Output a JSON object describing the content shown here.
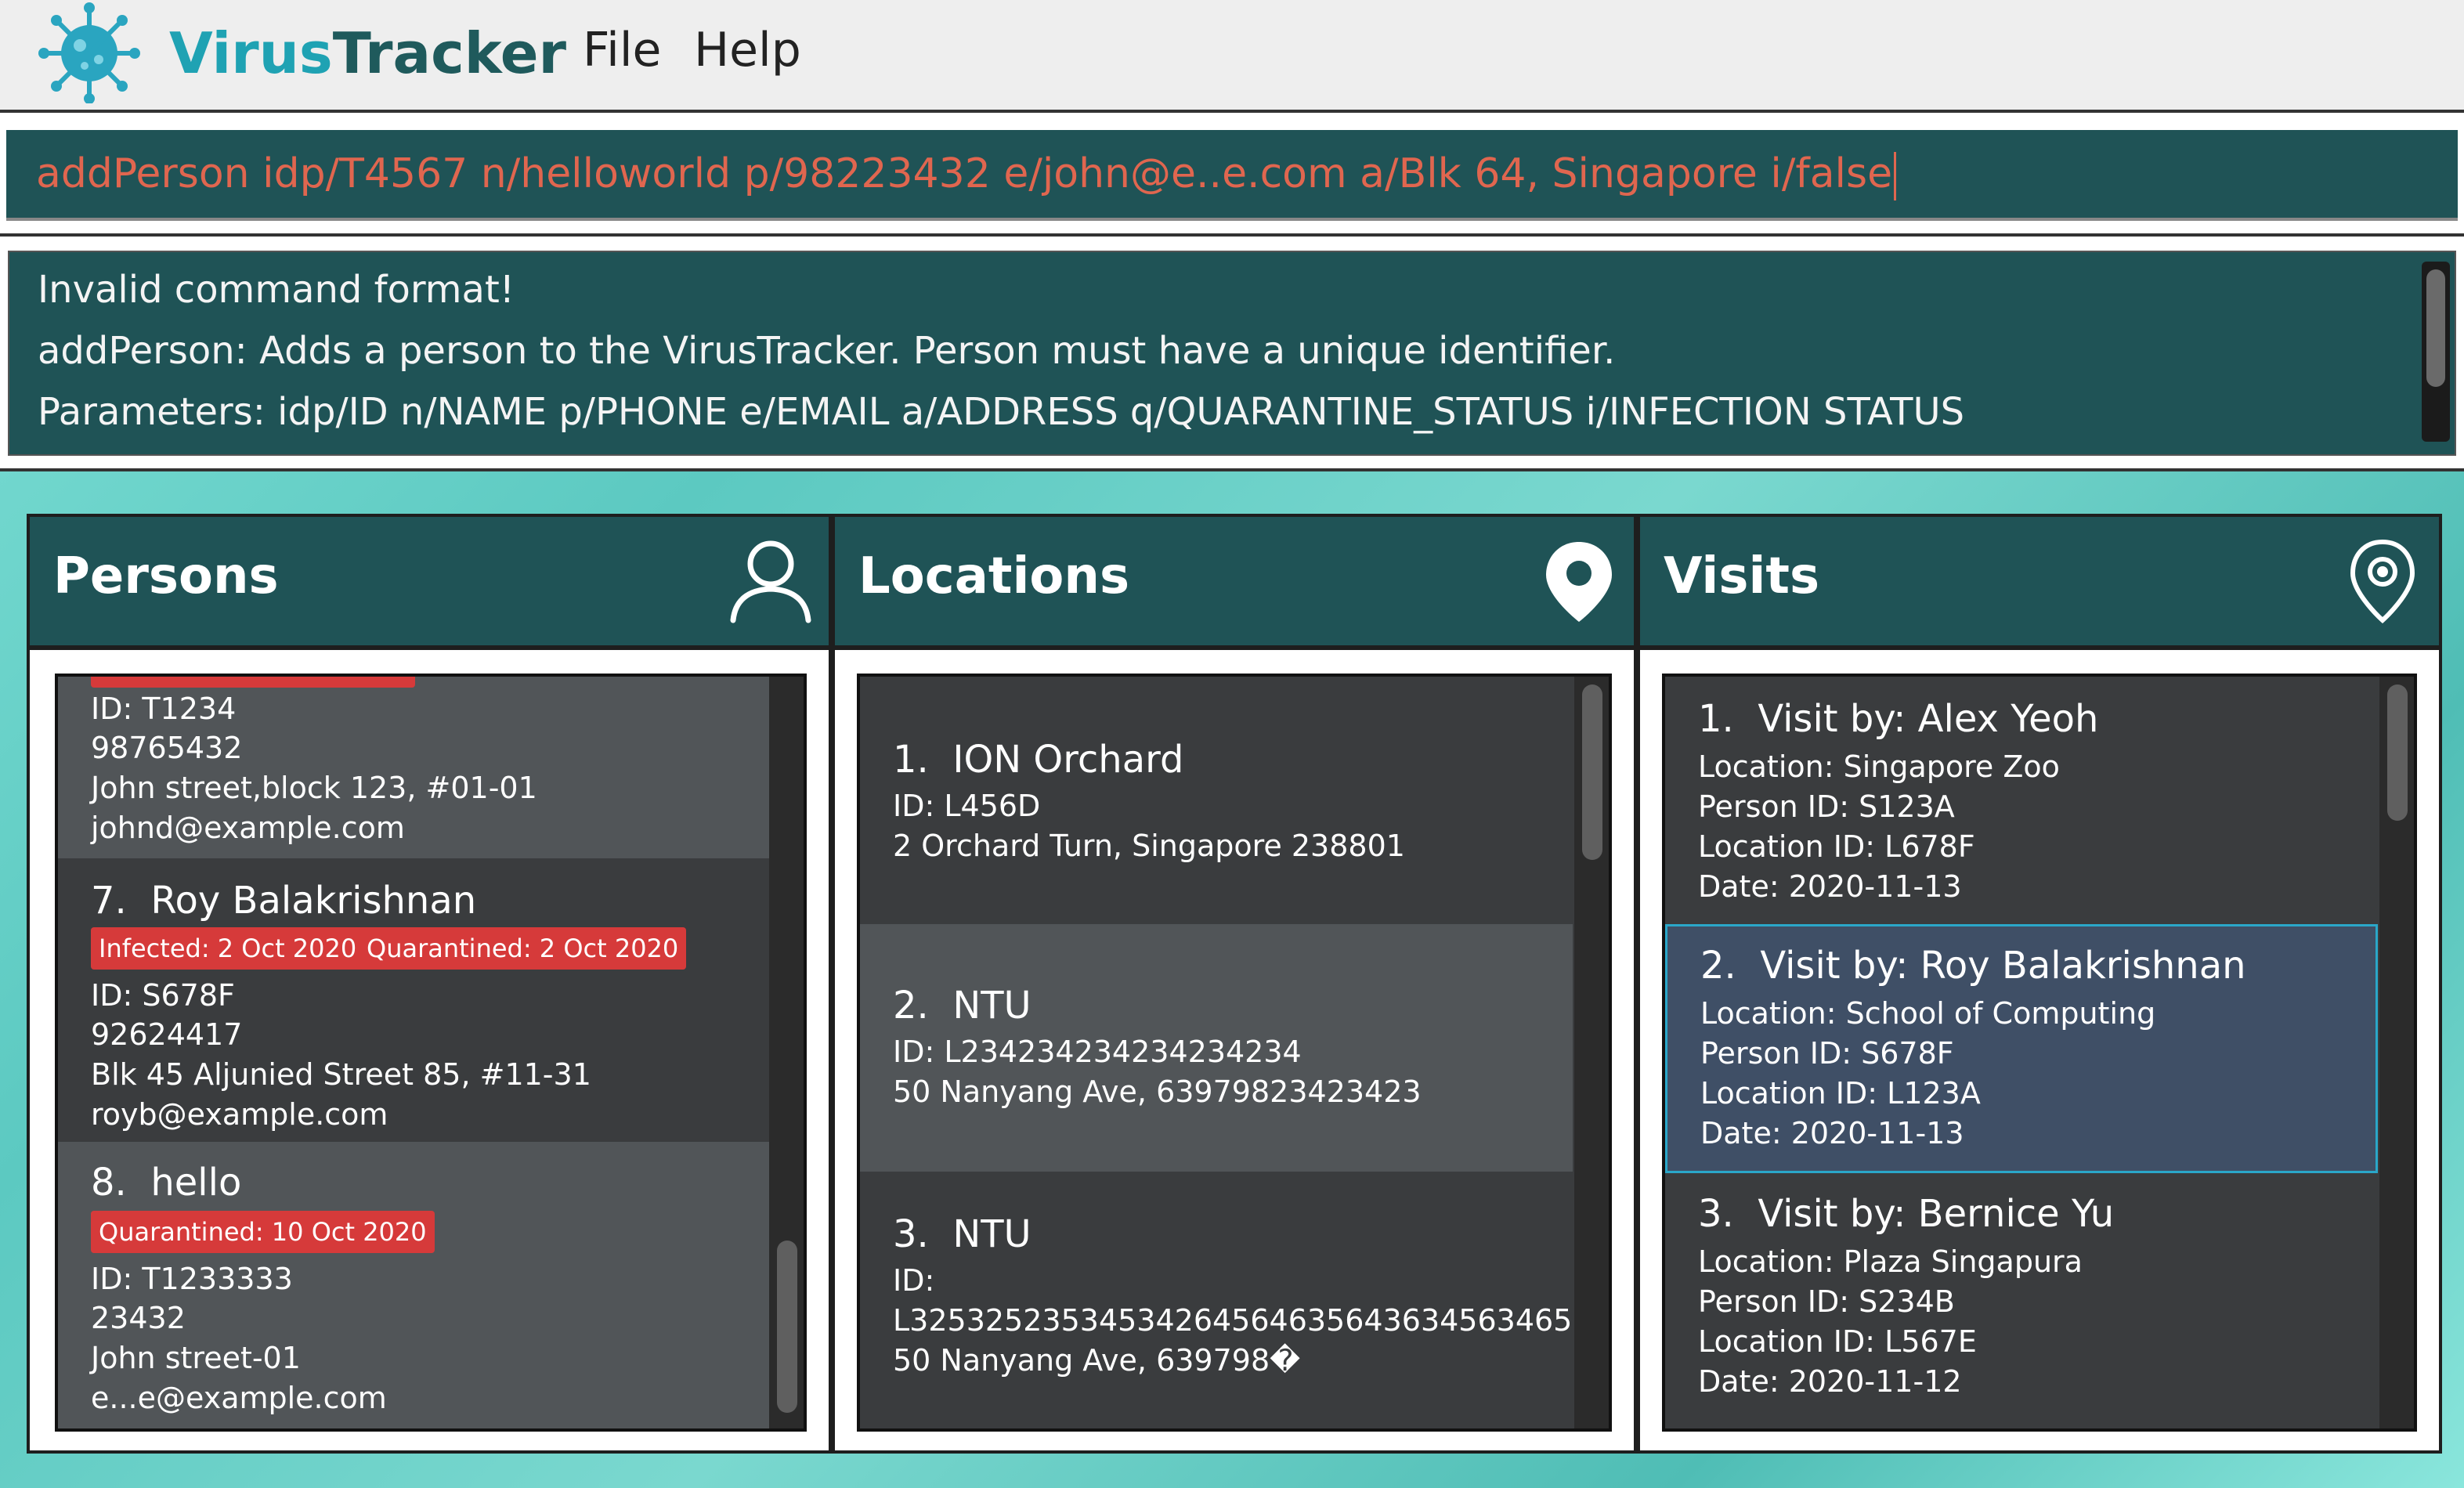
{
  "app": {
    "brand_part1": "Virus",
    "brand_part2": "Tracker",
    "logo_icon": "virus-icon",
    "brand_color_1": "#1fa2b3",
    "brand_color_2": "#1f5a5c"
  },
  "menu": {
    "file": "File",
    "help": "Help"
  },
  "command": {
    "value": "addPerson idp/T4567 n/helloworld p/98223432 e/john@e..e.com a/Blk 64, Singapore i/false",
    "text_color": "#e0664f"
  },
  "result": {
    "lines": [
      "Invalid command format!",
      "addPerson: Adds a person to the VirusTracker. Person must have a unique identifier.",
      "Parameters: idp/ID n/NAME p/PHONE e/EMAIL a/ADDRESS q/QUARANTINE_STATUS i/INFECTION STATUS"
    ]
  },
  "panels": {
    "persons": {
      "title": "Persons",
      "icon": "person-icon",
      "cards": [
        {
          "lines": [
            "ID: T1234",
            "98765432",
            "John street,block 123, #01-01",
            "johnd@example.com"
          ]
        },
        {
          "index": "7.",
          "name": "Roy Balakrishnan",
          "tags": [
            "Infected: 2 Oct 2020",
            "Quarantined: 2 Oct 2020"
          ],
          "lines": [
            "ID: S678F",
            "92624417",
            "Blk 45 Aljunied Street 85, #11-31",
            "royb@example.com"
          ]
        },
        {
          "index": "8.",
          "name": "hello",
          "tags": [
            "Quarantined: 10 Oct 2020"
          ],
          "lines": [
            "ID: T1233333",
            "23432",
            "John street-01",
            "e...e@example.com"
          ]
        }
      ]
    },
    "locations": {
      "title": "Locations",
      "icon": "location-pin-icon",
      "cards": [
        {
          "index": "1.",
          "name": "ION Orchard",
          "lines": [
            "ID: L456D",
            "2 Orchard Turn, Singapore 238801"
          ]
        },
        {
          "index": "2.",
          "name": "NTU",
          "lines": [
            "ID: L234234234234234234",
            "50 Nanyang Ave, 63979823423423"
          ]
        },
        {
          "index": "3.",
          "name": "NTU",
          "lines": [
            "ID:",
            "L32532523534534264564635643634563465",
            "50 Nanyang Ave, 639798�"
          ]
        }
      ]
    },
    "visits": {
      "title": "Visits",
      "icon": "map-pin-icon",
      "cards": [
        {
          "index": "1.",
          "name": "Visit by: Alex Yeoh",
          "lines": [
            "Location: Singapore Zoo",
            "Person ID: S123A",
            "Location ID: L678F",
            "Date: 2020-11-13"
          ]
        },
        {
          "index": "2.",
          "name": "Visit by: Roy Balakrishnan",
          "lines": [
            "Location: School of Computing",
            "Person ID: S678F",
            "Location ID: L123A",
            "Date: 2020-11-13"
          ]
        },
        {
          "index": "3.",
          "name": "Visit by: Bernice Yu",
          "lines": [
            "Location: Plaza Singapura",
            "Person ID: S234B",
            "Location ID: L567E",
            "Date: 2020-11-12"
          ]
        }
      ]
    }
  },
  "colors": {
    "panel_header": "#1f5356",
    "tag_red": "#d63a3a",
    "selected_border": "#2aa7c9"
  }
}
